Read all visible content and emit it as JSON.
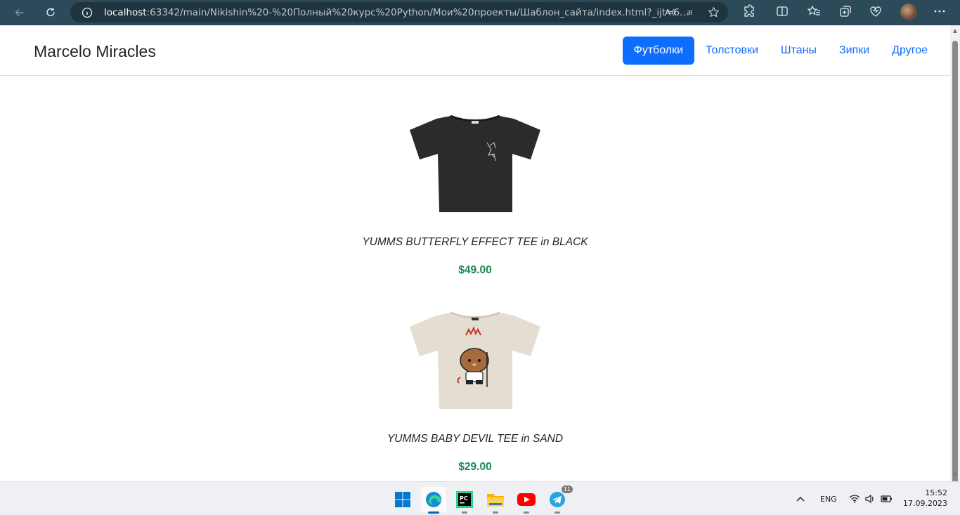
{
  "browser": {
    "url_host": "localhost",
    "url_path": ":63342/main/Nikishin%20-%20Полный%20курс%20Python/Мои%20проекты/Шаблон_сайта/index.html?_ijt=6..."
  },
  "site": {
    "brand": "Marcelo Miracles",
    "nav": [
      {
        "label": "Футболки",
        "active": true
      },
      {
        "label": "Толстовки",
        "active": false
      },
      {
        "label": "Штаны",
        "active": false
      },
      {
        "label": "Зипки",
        "active": false
      },
      {
        "label": "Другое",
        "active": false
      }
    ]
  },
  "products": [
    {
      "name": "YUMMS BUTTERFLY EFFECT TEE in BLACK",
      "price": "$49.00",
      "color": "#2b2b2b"
    },
    {
      "name": "YUMMS BABY DEVIL TEE in SAND",
      "price": "$29.00",
      "color": "#e4ddd2"
    }
  ],
  "colors": {
    "accent": "#0d6efd",
    "price": "#198754",
    "chrome": "#2d4a5a"
  },
  "taskbar": {
    "lang": "ENG",
    "time": "15:52",
    "date": "17.09.2023",
    "telegram_badge": "11"
  }
}
